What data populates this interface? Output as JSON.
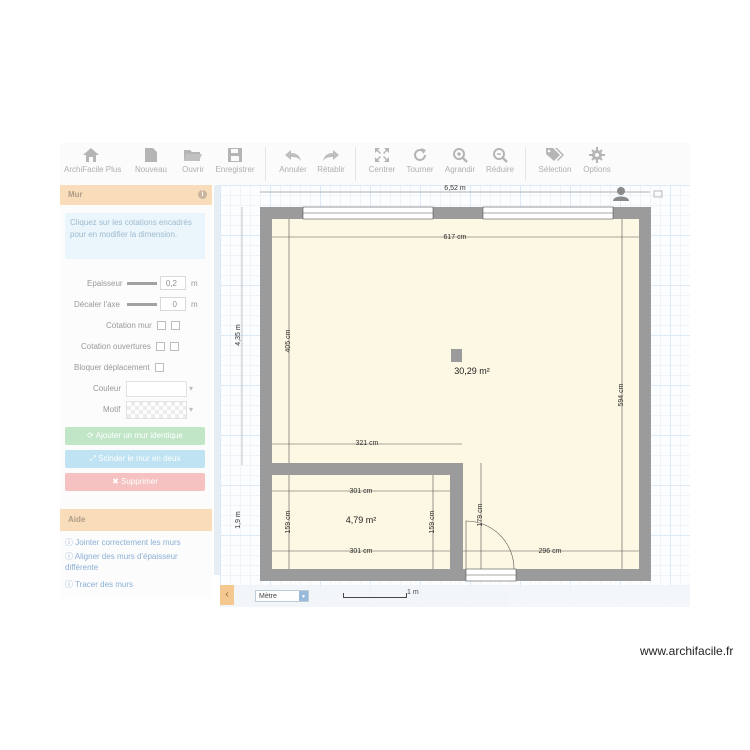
{
  "toolbar": {
    "items": [
      {
        "label": "ArchiFacile Plus",
        "icon": "home-icon"
      },
      {
        "label": "Nouveau",
        "icon": "file-icon"
      },
      {
        "label": "Ouvrir",
        "icon": "folder-icon"
      },
      {
        "label": "Enregistrer",
        "icon": "save-icon"
      },
      {
        "label": "Annuler",
        "icon": "undo-icon"
      },
      {
        "label": "Rétablir",
        "icon": "redo-icon"
      },
      {
        "label": "Centrer",
        "icon": "expand-icon"
      },
      {
        "label": "Tourner",
        "icon": "rotate-icon"
      },
      {
        "label": "Agrandir",
        "icon": "zoom-in-icon"
      },
      {
        "label": "Réduire",
        "icon": "zoom-out-icon"
      },
      {
        "label": "Sélection",
        "icon": "tags-icon"
      },
      {
        "label": "Options",
        "icon": "gear-icon"
      }
    ]
  },
  "panel": {
    "title": "Mur",
    "info_text": "Cliquez sur les cotations encadrés pour en modifier la dimension.",
    "epaisseur_label": "Epaisseur",
    "epaisseur_value": "0,2",
    "decaler_label": "Décaler l'axe",
    "decaler_value": "0",
    "unit": "m",
    "cotation_mur_label": "Cotation mur",
    "cotation_ouvertures_label": "Cotation ouvertures",
    "bloquer_label": "Bloquer déplacement",
    "couleur_label": "Couleur",
    "motif_label": "Motif",
    "btn_ajouter": "Ajouter un mur identique",
    "btn_scinder": "Scinder le mur en deux",
    "btn_supprimer": "Supprimer",
    "colors": {
      "green": "#8fd39a",
      "blue": "#8ccde8",
      "red": "#ee8f8f",
      "header": "#f5c385"
    }
  },
  "aide": {
    "title": "Aide",
    "links": [
      "Jointer correctement les murs",
      "Aligner des murs d'épaisseur différente",
      "Tracer des murs"
    ]
  },
  "plan": {
    "total_width": "6,52 m",
    "left_height_top": "4,35 m",
    "left_height_bottom": "1,9 m",
    "dims": {
      "top_inner": "617 cm",
      "left_inner": "405 cm",
      "right_inner": "594 cm",
      "mid": "321 cm",
      "small_top": "301 cm",
      "small_bottom": "301 cm",
      "small_left": "159 cm",
      "small_right": "159 cm",
      "door_height": "179 cm",
      "bottom_right": "296 cm"
    },
    "areas": {
      "big_room": "30,29 m²",
      "small_room": "4,79 m²"
    }
  },
  "bottom": {
    "unit_select": "Mètre",
    "scale": "1 m"
  },
  "credit": "www.archifacile.fr"
}
